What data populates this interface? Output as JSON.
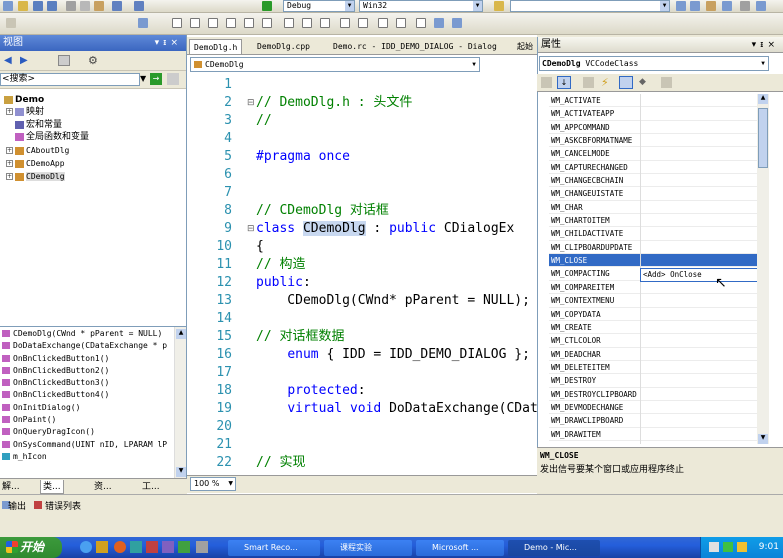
{
  "toolbar": {
    "config": "Debug",
    "platform": "Win32"
  },
  "classview": {
    "title": "视图",
    "search_placeholder": "<搜索>",
    "tree": [
      {
        "label": "Demo",
        "bold": true
      },
      {
        "label": "映射"
      },
      {
        "label": "宏和常量"
      },
      {
        "label": "全局函数和变量"
      },
      {
        "label": "CAboutDlg"
      },
      {
        "label": "CDemoApp"
      },
      {
        "label": "CDemoDlg",
        "selected": true
      }
    ]
  },
  "members": [
    "CDemoDlg(CWnd * pParent = NULL)",
    "DoDataExchange(CDataExchange * p",
    "OnBnClickedButton1()",
    "OnBnClickedButton2()",
    "OnBnClickedButton3()",
    "OnBnClickedButton4()",
    "OnInitDialog()",
    "OnPaint()",
    "OnQueryDragIcon()",
    "OnSysCommand(UINT nID, LPARAM lP",
    "m_hIcon"
  ],
  "left_tabs": [
    "解...",
    "类...",
    "资...",
    "工..."
  ],
  "editor": {
    "tabs": [
      "DemoDlg.h",
      "DemoDlg.cpp",
      "Demo.rc - IDD_DEMO_DIALOG - Dialog",
      "起始"
    ],
    "nav": "CDemoDlg",
    "zoom": "100 %",
    "lines": [
      {
        "n": "1",
        "parts": []
      },
      {
        "n": "2",
        "parts": [
          {
            "t": "// DemoDlg.h : 头文件",
            "c": "cm"
          }
        ]
      },
      {
        "n": "3",
        "parts": [
          {
            "t": "//",
            "c": "cm"
          }
        ]
      },
      {
        "n": "4",
        "parts": []
      },
      {
        "n": "5",
        "parts": [
          {
            "t": "#pragma once",
            "c": "kw"
          }
        ]
      },
      {
        "n": "6",
        "parts": []
      },
      {
        "n": "7",
        "parts": []
      },
      {
        "n": "8",
        "parts": [
          {
            "t": "// CDemoDlg 对话框",
            "c": "cm"
          }
        ]
      },
      {
        "n": "9",
        "parts": [
          {
            "t": "class ",
            "c": "kw"
          },
          {
            "t": "CDemoDlg",
            "c": "hl"
          },
          {
            "t": " : ",
            "c": ""
          },
          {
            "t": "public",
            "c": "kw"
          },
          {
            "t": " CDialogEx",
            "c": ""
          }
        ]
      },
      {
        "n": "10",
        "parts": [
          {
            "t": "{",
            "c": ""
          }
        ]
      },
      {
        "n": "11",
        "parts": [
          {
            "t": "// 构造",
            "c": "cm"
          }
        ]
      },
      {
        "n": "12",
        "parts": [
          {
            "t": "public",
            "c": "kw"
          },
          {
            "t": ":",
            "c": ""
          }
        ]
      },
      {
        "n": "13",
        "parts": [
          {
            "t": "    CDemoDlg(CWnd* pParent = NULL);",
            "c": ""
          }
        ]
      },
      {
        "n": "14",
        "parts": []
      },
      {
        "n": "15",
        "parts": [
          {
            "t": "// 对话框数据",
            "c": "cm"
          }
        ]
      },
      {
        "n": "16",
        "parts": [
          {
            "t": "    ",
            "c": ""
          },
          {
            "t": "enum",
            "c": "kw"
          },
          {
            "t": " { IDD = IDD_DEMO_DIALOG };",
            "c": ""
          }
        ]
      },
      {
        "n": "17",
        "parts": []
      },
      {
        "n": "18",
        "parts": [
          {
            "t": "    ",
            "c": ""
          },
          {
            "t": "protected",
            "c": "kw"
          },
          {
            "t": ":",
            "c": ""
          }
        ]
      },
      {
        "n": "19",
        "parts": [
          {
            "t": "    ",
            "c": ""
          },
          {
            "t": "virtual",
            "c": "kw"
          },
          {
            "t": " ",
            "c": ""
          },
          {
            "t": "void",
            "c": "kw"
          },
          {
            "t": " DoDataExchange(CDat",
            "c": ""
          }
        ]
      },
      {
        "n": "20",
        "parts": []
      },
      {
        "n": "21",
        "parts": []
      },
      {
        "n": "22",
        "parts": [
          {
            "t": "// 实现",
            "c": "cm"
          }
        ]
      }
    ]
  },
  "props": {
    "title": "属性",
    "object": "CDemoDlg",
    "object_type": "VCCodeClass",
    "messages": [
      "WM_ACTIVATE",
      "WM_ACTIVATEAPP",
      "WM_APPCOMMAND",
      "WM_ASKCBFORMATNAME",
      "WM_CANCELMODE",
      "WM_CAPTURECHANGED",
      "WM_CHANGECBCHAIN",
      "WM_CHANGEUISTATE",
      "WM_CHAR",
      "WM_CHARTOITEM",
      "WM_CHILDACTIVATE",
      "WM_CLIPBOARDUPDATE",
      "WM_CLOSE",
      "WM_COMPACTING",
      "WM_COMPAREITEM",
      "WM_CONTEXTMENU",
      "WM_COPYDATA",
      "WM_CREATE",
      "WM_CTLCOLOR",
      "WM_DEADCHAR",
      "WM_DELETEITEM",
      "WM_DESTROY",
      "WM_DESTROYCLIPBOARD",
      "WM_DEVMODECHANGE",
      "WM_DRAWCLIPBOARD",
      "WM_DRAWITEM"
    ],
    "selected_message": "WM_CLOSE",
    "handler": "<Add> OnClose",
    "desc_title": "WM_CLOSE",
    "desc_text": "发出信号要某个窗口或应用程序终止"
  },
  "output_tabs": [
    "输出",
    "错误列表"
  ],
  "taskbar": {
    "start": "开始",
    "tasks": [
      "Smart Reco...",
      "课程实验",
      "Microsoft ...",
      "Demo - Mic..."
    ],
    "clock": "9:01"
  }
}
